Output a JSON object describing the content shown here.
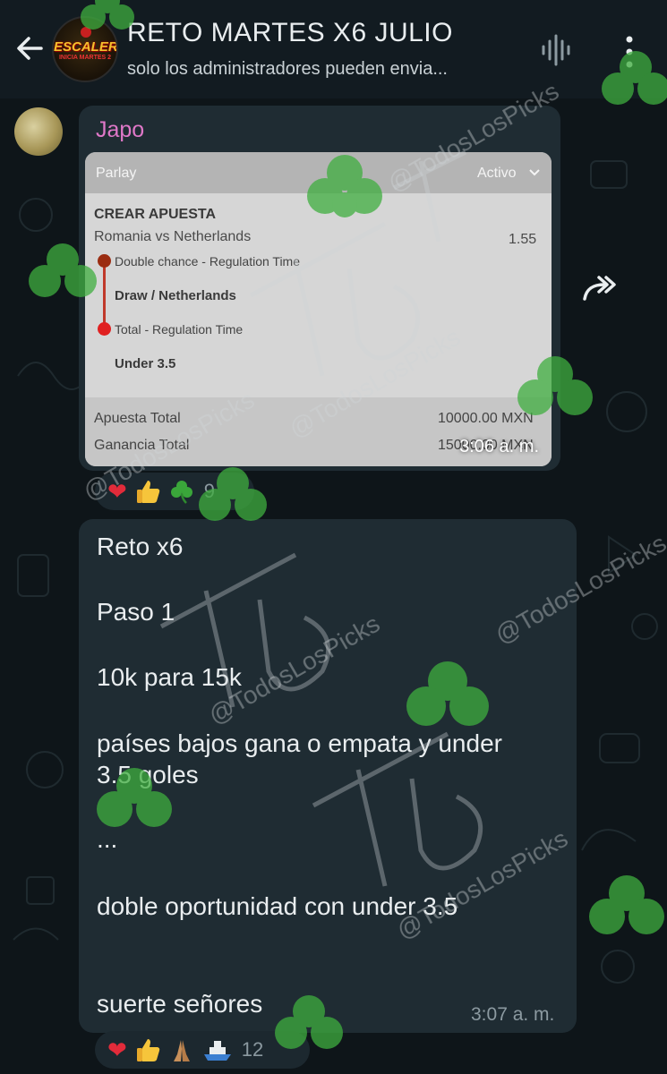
{
  "header": {
    "back_icon": "arrow-left-icon",
    "group_avatar_text": "ESCALERA",
    "group_avatar_subtext": "INICIA MARTES 2",
    "title": "RETO MARTES X6 JULIO",
    "subtitle": "solo los administradores pueden envia...",
    "voice_icon": "voice-call-icon",
    "menu_icon": "more-vertical-icon"
  },
  "colors": {
    "background": "#0e1519",
    "header": "#121b21",
    "bubble": "#1f2c33",
    "sender_name": "#df78c8",
    "watermark_clover": "#3fae3f"
  },
  "message1": {
    "sender": "Japo",
    "ticket": {
      "header_left": "Parlay",
      "header_right": "Activo",
      "section_title": "CREAR APUESTA",
      "match": "Romania vs Netherlands",
      "odds": "1.55",
      "leg1_market": "Double chance - Regulation Time",
      "leg1_pick": "Draw / Netherlands",
      "leg2_market": "Total - Regulation Time",
      "leg2_pick": "Under 3.5",
      "stake_label": "Apuesta Total",
      "stake_value": "10000.00 MXN",
      "payout_label": "Ganancia Total",
      "payout_value": "15000.00 MXN"
    },
    "time": "3:06 a. m.",
    "reactions": {
      "emojis": [
        "red-heart",
        "thumbs-up",
        "shamrock"
      ],
      "count": "9"
    }
  },
  "forward_icon": "forward-icon",
  "message2": {
    "lines": [
      "Reto x6",
      "Paso 1",
      "10k para 15k",
      "países bajos gana o empata y under",
      "3.5 goles",
      "...",
      "doble oportunidad con under 3.5",
      "suerte señores"
    ],
    "time": "3:07 a. m.",
    "reactions": {
      "emojis": [
        "red-heart",
        "thumbs-up",
        "folded-hands",
        "ship"
      ],
      "count": "12"
    }
  },
  "watermark": {
    "text": "@TodosLosPicks"
  }
}
